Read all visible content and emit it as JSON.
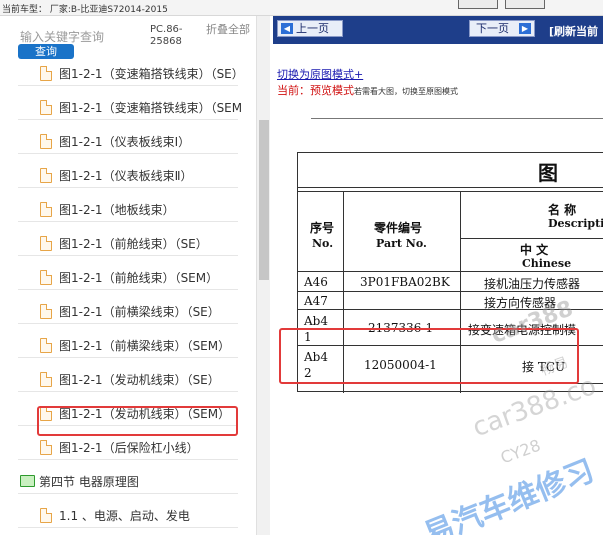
{
  "topbar": {
    "vehicle_text": "当前车型： 厂家:B-比亚迪S72014-2015"
  },
  "left": {
    "search_placeholder": "输入关键字查询",
    "search_button": "查询",
    "pc_number": "PC.86-25868",
    "collapse_all": "折叠全部",
    "items": [
      {
        "label": "图1-2-1（变速箱搭铁线束）（SE）"
      },
      {
        "label": "图1-2-1（变速箱搭铁线束）（SEM"
      },
      {
        "label": "图1-2-1（仪表板线束Ⅰ）"
      },
      {
        "label": "图1-2-1（仪表板线束Ⅱ）"
      },
      {
        "label": "图1-2-1（地板线束）"
      },
      {
        "label": "图1-2-1（前舱线束）（SE）"
      },
      {
        "label": "图1-2-1（前舱线束）（SEM）"
      },
      {
        "label": "图1-2-1（前横梁线束）（SE）"
      },
      {
        "label": "图1-2-1（前横梁线束）（SEM）"
      },
      {
        "label": "图1-2-1（发动机线束）（SE）"
      },
      {
        "label": "图1-2-1（发动机线束）（SEM）"
      },
      {
        "label": "图1-2-1（后保险杠小线）"
      }
    ],
    "folder": {
      "label": "第四节 电器原理图"
    },
    "last_item": {
      "label": "1.1 、电源、启动、发电"
    }
  },
  "right": {
    "prev_button": "上一页",
    "next_button": "下一页",
    "refresh": "[刷新当前",
    "mode_link": "切换为原图模式+",
    "current_label": "当前：",
    "current_mode": "预览模式",
    "current_hint": "若需看大图，切换至原图模式",
    "table": {
      "title": "图",
      "col_seq_cn": "序号",
      "col_seq_en": "No.",
      "col_part_cn": "零件编号",
      "col_part_en": "Part No.",
      "col_name_cn": "名    称",
      "col_desc_en": "Description",
      "col_zh_cn": "中    文",
      "col_chinese_en": "Chinese",
      "rows": [
        {
          "no": "A46",
          "part": "3P01FBA02BK",
          "name": "接机油压力传感器"
        },
        {
          "no": "A47",
          "part": "",
          "name": "接方向传感器"
        },
        {
          "no": "Ab4 1",
          "part": "2137336-1",
          "name": "接变速箱电源控制模"
        },
        {
          "no": "Ab4 2",
          "part": "12050004-1",
          "name": "接 TCU"
        }
      ]
    }
  },
  "watermarks": [
    "car388",
    "畅易",
    "car388.co",
    "CY28",
    "易汽车维修习"
  ]
}
